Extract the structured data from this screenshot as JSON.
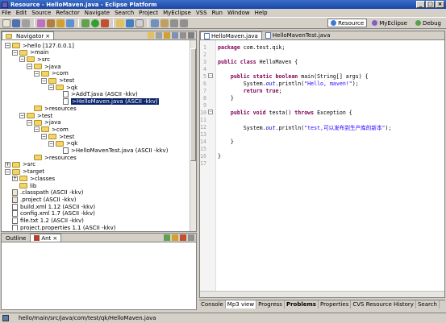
{
  "window": {
    "title": "Resource - HelloMaven.java - Eclipse Platform"
  },
  "menu": [
    "File",
    "Edit",
    "Source",
    "Refactor",
    "Navigate",
    "Search",
    "Project",
    "MyEclipse",
    "VSS",
    "Run",
    "Window",
    "Help"
  ],
  "perspectives": [
    {
      "label": "Resource",
      "color": "#3a7bd5",
      "active": true
    },
    {
      "label": "MyEclipse",
      "color": "#8a5bc0",
      "active": false
    },
    {
      "label": "Debug",
      "color": "#5aa04a",
      "active": false
    }
  ],
  "navigator": {
    "tab_label": "Navigator",
    "tree": [
      {
        "label": ">hello  [127.0.0.1]",
        "depth": 0,
        "expanded": true,
        "kind": "project"
      },
      {
        "label": ">main",
        "depth": 1,
        "expanded": true,
        "kind": "folder"
      },
      {
        "label": ">src",
        "depth": 2,
        "expanded": true,
        "kind": "folder"
      },
      {
        "label": ">java",
        "depth": 3,
        "expanded": true,
        "kind": "folder"
      },
      {
        "label": ">com",
        "depth": 4,
        "expanded": true,
        "kind": "folder"
      },
      {
        "label": ">test",
        "depth": 5,
        "expanded": true,
        "kind": "folder"
      },
      {
        "label": ">qk",
        "depth": 6,
        "expanded": true,
        "kind": "folder"
      },
      {
        "label": ">AddT.java    (ASCII -kkv)",
        "depth": 7,
        "kind": "file"
      },
      {
        "label": ">HelloMaven.java    (ASCII -kkv)",
        "depth": 7,
        "kind": "file",
        "selected": true
      },
      {
        "label": ">resources",
        "depth": 3,
        "kind": "folder"
      },
      {
        "label": ">test",
        "depth": 2,
        "expanded": true,
        "kind": "folder"
      },
      {
        "label": ">java",
        "depth": 3,
        "expanded": true,
        "kind": "folder"
      },
      {
        "label": ">com",
        "depth": 4,
        "expanded": true,
        "kind": "folder"
      },
      {
        "label": ">test",
        "depth": 5,
        "expanded": true,
        "kind": "folder"
      },
      {
        "label": ">qk",
        "depth": 6,
        "expanded": true,
        "kind": "folder"
      },
      {
        "label": ">HelloMavenTest.java    (ASCII -kkv)",
        "depth": 7,
        "kind": "file"
      },
      {
        "label": ">resources",
        "depth": 3,
        "kind": "folder"
      },
      {
        "label": ">src",
        "depth": 0,
        "expanded": false,
        "kind": "folder"
      },
      {
        "label": ">target",
        "depth": 0,
        "expanded": true,
        "kind": "folder"
      },
      {
        "label": ">classes",
        "depth": 1,
        "expanded": false,
        "kind": "folder"
      },
      {
        "label": "lib",
        "depth": 1,
        "kind": "folder"
      },
      {
        "label": ".classpath    (ASCII -kkv)",
        "depth": 0,
        "kind": "xfile"
      },
      {
        "label": ".project    (ASCII -kkv)",
        "depth": 0,
        "kind": "xfile"
      },
      {
        "label": "build.xml 1.12  (ASCII -kkv)",
        "depth": 0,
        "kind": "file"
      },
      {
        "label": "config.xml 1.7  (ASCII -kkv)",
        "depth": 0,
        "kind": "file"
      },
      {
        "label": "file.txt  1.2  (ASCII -kkv)",
        "depth": 0,
        "kind": "file"
      },
      {
        "label": "project.properties  1.1  (ASCII -kkv)",
        "depth": 0,
        "kind": "file"
      }
    ]
  },
  "outline": {
    "tabs": [
      "Outline",
      "Ant"
    ]
  },
  "editor": {
    "tabs": [
      {
        "label": "HelloMaven.java",
        "active": true
      },
      {
        "label": "HelloMavenTest.java",
        "active": false
      }
    ],
    "lines": [
      {
        "n": "1",
        "html": "<span class='kw'>package</span> com.test.qik;"
      },
      {
        "n": "2",
        "html": ""
      },
      {
        "n": "3",
        "html": "<span class='kw'>public class</span> HelloMaven {"
      },
      {
        "n": "4",
        "html": ""
      },
      {
        "n": "5",
        "html": "    <span class='kw'>public static boolean</span> main(String[] args) {",
        "fold": true
      },
      {
        "n": "6",
        "html": "        System.<span class='fld'>out</span>.println(<span class='str'>\"Hello, maven!\"</span>);"
      },
      {
        "n": "7",
        "html": "        <span class='kw'>return true</span>;"
      },
      {
        "n": "8",
        "html": "    }"
      },
      {
        "n": "9",
        "html": ""
      },
      {
        "n": "10",
        "html": "    <span class='kw'>public void</span> testa() <span class='kw'>throws</span> Exception {",
        "fold": true
      },
      {
        "n": "11",
        "html": ""
      },
      {
        "n": "12",
        "html": "        System.<span class='fld'>out</span>.println(<span class='str'>\"test,可以发布到生产库的新本\"</span>);"
      },
      {
        "n": "13",
        "html": ""
      },
      {
        "n": "14",
        "html": "    }"
      },
      {
        "n": "15",
        "html": ""
      },
      {
        "n": "16",
        "html": "}"
      },
      {
        "n": "17",
        "html": ""
      }
    ]
  },
  "bottom_tabs": [
    {
      "label": "Console",
      "active": false
    },
    {
      "label": "Mp3 view",
      "active": true
    },
    {
      "label": "Progress",
      "active": false
    },
    {
      "label": "Problems",
      "active": false,
      "bold": true
    },
    {
      "label": "Properties",
      "active": false
    },
    {
      "label": "CVS Resource History",
      "active": false
    },
    {
      "label": "Search",
      "active": false
    }
  ],
  "status": {
    "path": "hello/main/src/java/com/test/qk/HelloMaven.java"
  }
}
